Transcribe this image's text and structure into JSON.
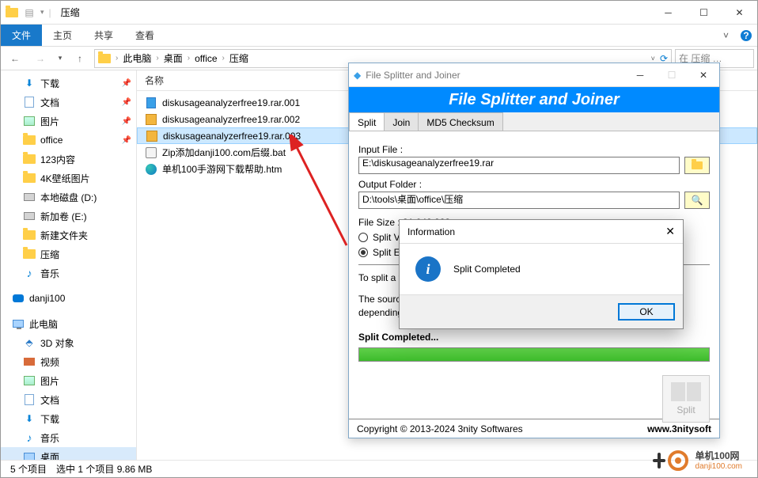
{
  "explorer": {
    "window_title": "压缩",
    "menu": {
      "file": "文件",
      "home": "主页",
      "share": "共享",
      "view": "查看"
    },
    "breadcrumb": [
      "此电脑",
      "桌面",
      "office",
      "压缩"
    ],
    "search_placeholder": "在 压缩 …",
    "col_name": "名称",
    "sidebar": {
      "downloads": "下载",
      "documents": "文档",
      "pictures": "图片",
      "office": "office",
      "item123": "123内容",
      "wallpaper": "4K壁纸图片",
      "localdisk": "本地磁盘 (D:)",
      "newvol": "新加卷 (E:)",
      "newfolder": "新建文件夹",
      "compress": "压缩",
      "music": "音乐",
      "danji": "danji100",
      "thispc": "此电脑",
      "objects3d": "3D 对象",
      "videos": "视频",
      "pictures2": "图片",
      "documents2": "文档",
      "downloads2": "下载",
      "music2": "音乐",
      "desktop": "桌面"
    },
    "files": [
      {
        "name": "diskusageanalyzerfree19.rar.001",
        "icon": "blue"
      },
      {
        "name": "diskusageanalyzerfree19.rar.002",
        "icon": "archive"
      },
      {
        "name": "diskusageanalyzerfree19.rar.003",
        "icon": "archive",
        "sel": true
      },
      {
        "name": "Zip添加danji100.com后缀.bat",
        "icon": "bat"
      },
      {
        "name": "单机100手游网下载帮助.htm",
        "icon": "edge"
      }
    ],
    "status": {
      "count": "5 个项目",
      "selected": "选中 1 个项目  9.86 MB"
    }
  },
  "fsj": {
    "title": "File Splitter and Joiner",
    "banner": "File Splitter and Joiner",
    "tabs": {
      "split": "Split",
      "join": "Join",
      "md5": "MD5 Checksum"
    },
    "input_label": "Input File :",
    "input_value": "E:\\diskusageanalyzerfree19.rar",
    "output_label": "Output Folder :",
    "output_value": "D:\\tools\\桌面\\office\\压缩",
    "filesize_label": "File Size : 31,042,823",
    "opt_specified": "Split V",
    "opt_equal": "Split E",
    "help1": "To split a file, please specify the source file and the output directory.",
    "help2": "The source file can be split into equal-size parts or size-limited parts depending on your preference.",
    "completed": "Split Completed...",
    "split_label": "Split",
    "copyright": "Copyright © 2013-2024 3nity Softwares",
    "url": "www.3nitysoft"
  },
  "msg": {
    "title": "Information",
    "text": "Split Completed",
    "ok": "OK"
  },
  "watermark": {
    "name": "单机100网",
    "sub": "danji100.com"
  }
}
